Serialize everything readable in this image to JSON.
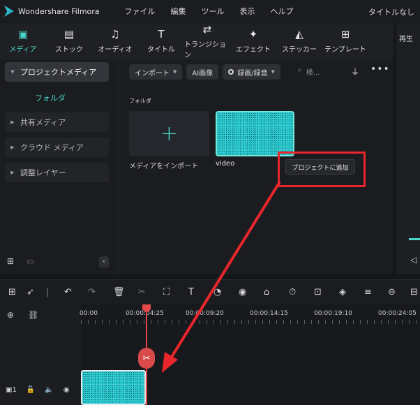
{
  "app": {
    "name": "Wondershare Filmora",
    "window_title": "タイトルなし"
  },
  "menu": [
    "ファイル",
    "編集",
    "ツール",
    "表示",
    "ヘルプ"
  ],
  "toolbar": [
    {
      "label": "メディア",
      "icon": "media-icon",
      "active": true
    },
    {
      "label": "ストック",
      "icon": "stock-icon"
    },
    {
      "label": "オーディオ",
      "icon": "music-note-icon"
    },
    {
      "label": "タイトル",
      "icon": "title-t-icon"
    },
    {
      "label": "トランジション",
      "icon": "transition-icon"
    },
    {
      "label": "エフェクト",
      "icon": "effects-icon"
    },
    {
      "label": "ステッカー",
      "icon": "sticker-icon"
    },
    {
      "label": "テンプレート",
      "icon": "template-icon"
    }
  ],
  "right_panel": {
    "label": "再生"
  },
  "sidebar": {
    "project_media": "プロジェクトメディア",
    "folder": "フォルダ",
    "items": [
      "共有メディア",
      "クラウド メディア",
      "調整レイヤー"
    ]
  },
  "media": {
    "filters": {
      "import": "インポート",
      "ai_image": "AI画像",
      "record": "録画/録音"
    },
    "search_placeholder": "検...",
    "folder_label": "フォルダ",
    "import_label": "メディアをインポート",
    "video_label": "video",
    "tooltip": "プロジェクトに追加"
  },
  "timeline": {
    "ticks": [
      "00:00",
      "00:00:04:25",
      "00:00:09:20",
      "00:00:14:15",
      "00:00:19:10",
      "00:00:24:05"
    ],
    "track_number": "1"
  },
  "colors": {
    "accent": "#48d7c8",
    "annotation_red": "#e8262b"
  }
}
